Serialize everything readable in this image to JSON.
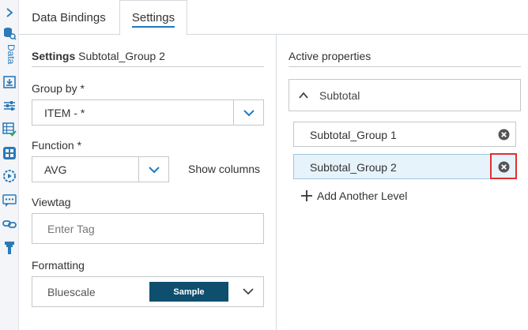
{
  "sidebar": {
    "data_label": "Data",
    "icons": [
      "chevron-right-icon",
      "database-search-icon",
      "download-box-icon",
      "sliders-icon",
      "table-check-icon",
      "grid-icon",
      "play-cog-icon",
      "chat-icon",
      "link-icon",
      "filter-icon"
    ]
  },
  "tabs": [
    {
      "label": "Data Bindings",
      "active": false
    },
    {
      "label": "Settings",
      "active": true
    }
  ],
  "settings": {
    "title_bold": "Settings",
    "title_name": "Subtotal_Group 2",
    "group_by": {
      "label": "Group by *",
      "value": "ITEM - *"
    },
    "function": {
      "label": "Function *",
      "value": "AVG"
    },
    "show_columns_label": "Show columns",
    "viewtag": {
      "label": "Viewtag",
      "placeholder": "Enter Tag",
      "value": ""
    },
    "formatting": {
      "label": "Formatting",
      "value": "Bluescale",
      "sample_label": "Sample",
      "sample_color": "#0f4f6e"
    }
  },
  "active_properties": {
    "title": "Active properties",
    "accordion_label": "Subtotal",
    "levels": [
      {
        "label": "Subtotal_Group 1",
        "active": false
      },
      {
        "label": "Subtotal_Group 2",
        "active": true
      }
    ],
    "add_level_label": "Add Another Level"
  },
  "colors": {
    "accent": "#1f7ac0",
    "highlight": "#e03030",
    "active_row": "#e6f3fb"
  }
}
